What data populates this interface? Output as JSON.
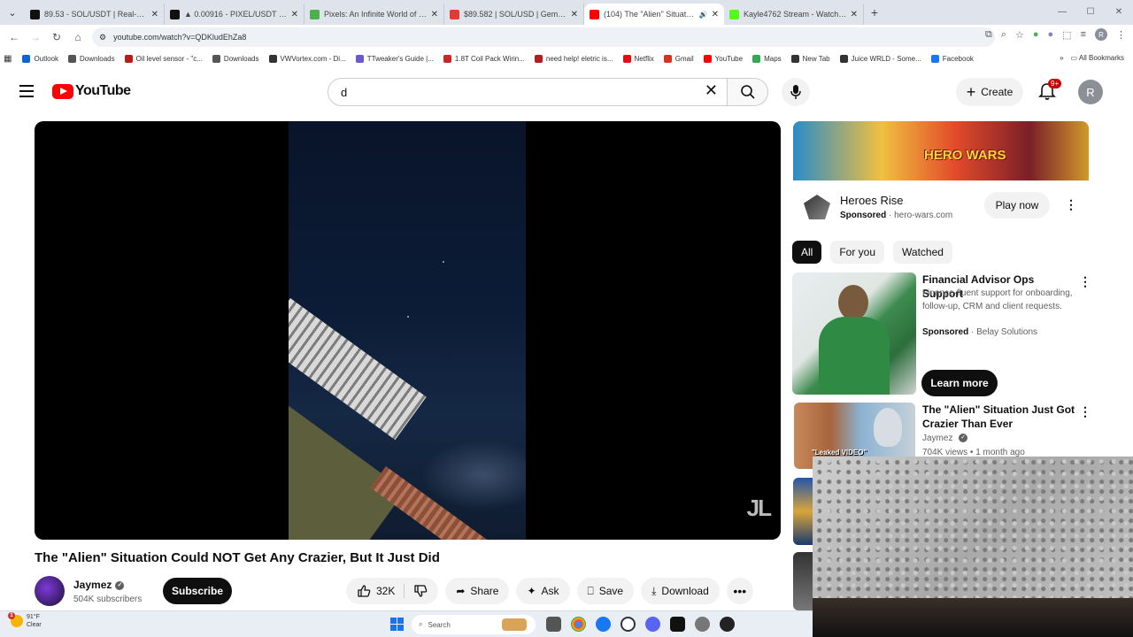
{
  "browser": {
    "tabs": [
      {
        "title": "89.53 - SOL/USDT | Real-Tim",
        "color": "#111111",
        "active": false
      },
      {
        "title": "▲ 0.00916 - PIXEL/USDT | Real-",
        "color": "#111111",
        "active": false
      },
      {
        "title": "Pixels: An Infinite World of End",
        "color": "#4caf50",
        "active": false
      },
      {
        "title": "$89.582 | SOL/USD | Gemini -",
        "color": "#e53935",
        "active": false
      },
      {
        "title": "(104) The \"Alien\" Situation",
        "color": "#ff0000",
        "active": true
      },
      {
        "title": "Kayle4762 Stream - Watch Live",
        "color": "#53fc18",
        "active": false
      }
    ],
    "url": "youtube.com/watch?v=QDKludEhZa8",
    "profile_initial": "R",
    "bookmarks": [
      {
        "label": "Outlook",
        "color": "#0a64d6"
      },
      {
        "label": "Downloads",
        "color": "#555555"
      },
      {
        "label": "Oil level sensor - \"c...",
        "color": "#b71c1c"
      },
      {
        "label": "Downloads",
        "color": "#555555"
      },
      {
        "label": "VWVortex.com - Di...",
        "color": "#333333"
      },
      {
        "label": "TTweaker's Guide |...",
        "color": "#6a5acd"
      },
      {
        "label": "1.8T Coil Pack Wirin...",
        "color": "#c62828"
      },
      {
        "label": "need help! eletric is...",
        "color": "#b71c1c"
      },
      {
        "label": "Netflix",
        "color": "#e50914"
      },
      {
        "label": "Gmail",
        "color": "#d93025"
      },
      {
        "label": "YouTube",
        "color": "#ff0000"
      },
      {
        "label": "Maps",
        "color": "#34a853"
      },
      {
        "label": "New Tab",
        "color": "#333333"
      },
      {
        "label": "Juice WRLD - Some...",
        "color": "#333333"
      },
      {
        "label": "Facebook",
        "color": "#1877f2"
      }
    ],
    "all_bookmarks": "All Bookmarks"
  },
  "youtube": {
    "logo_text": "YouTube",
    "search_value": "d",
    "create_label": "Create",
    "notif_badge": "9+",
    "user_initial": "R"
  },
  "video": {
    "title": "The \"Alien\" Situation Could NOT Get Any Crazier, But It Just Did",
    "watermark": "JL",
    "channel": "Jaymez",
    "subscribers": "504K subscribers",
    "subscribe_label": "Subscribe",
    "likes": "32K",
    "share_label": "Share",
    "ask_label": "Ask",
    "save_label": "Save",
    "download_label": "Download"
  },
  "ad": {
    "banner_text": "HERO WARS",
    "title": "Heroes Rise",
    "sponsored": "Sponsored",
    "domain": "hero-wars.com",
    "cta": "Play now"
  },
  "chips": [
    "All",
    "For you",
    "Watched"
  ],
  "recommendations": [
    {
      "title": "Financial Advisor Ops Support",
      "desc": "Finance-fluent support for onboarding, follow-up, CRM and client requests.",
      "sponsored": "Sponsored",
      "advertiser": "Belay Solutions",
      "cta": "Learn more"
    },
    {
      "title": "The \"Alien\" Situation Just Got Crazier Than Ever",
      "channel": "Jaymez",
      "meta": "704K views • 1 month ago",
      "thumb_label": "\"Leaked VIDEO\""
    }
  ],
  "taskbar": {
    "temp": "91°F",
    "cond": "Clear",
    "weather_badge": "1",
    "search_label": "Search"
  }
}
